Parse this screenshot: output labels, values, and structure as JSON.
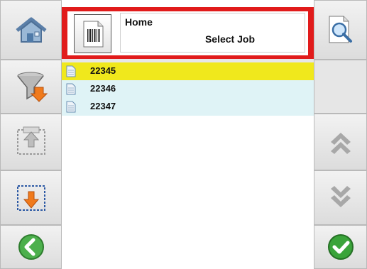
{
  "header": {
    "title": "Home",
    "subtitle": "Select Job"
  },
  "jobs": [
    {
      "id": "22345",
      "selected": true
    },
    {
      "id": "22346",
      "selected": false
    },
    {
      "id": "22347",
      "selected": false
    }
  ],
  "left_buttons": [
    "home-icon",
    "filter-icon",
    "move-up-icon",
    "move-down-icon",
    "back-icon"
  ],
  "right_buttons": [
    "search-icon",
    "blank",
    "scroll-up-icon",
    "scroll-down-icon",
    "confirm-icon"
  ],
  "colors": {
    "header_border": "#e11b1b",
    "selected_row": "#f0e81c",
    "row_tint": "#dff3f6",
    "confirm": "#3aa43a"
  }
}
